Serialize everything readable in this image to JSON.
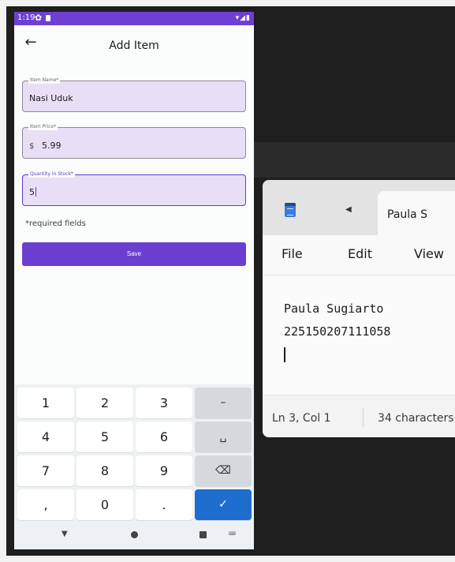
{
  "phone": {
    "status_bar": {
      "time": "1:19",
      "settings_icon": "gear-icon",
      "sys_icons": "▾◢▮"
    },
    "appbar": {
      "title": "Add Item",
      "back_icon": "arrow-left-icon"
    },
    "fields": {
      "item_name": {
        "label": "Item Name*",
        "value": "Nasi Uduk"
      },
      "item_price": {
        "label": "Item Price*",
        "prefix": "$",
        "value": "5.99"
      },
      "quantity": {
        "label": "Quantity in Stock*",
        "value": "5"
      }
    },
    "required_note": "*required fields",
    "save_label": "Save",
    "keypad": {
      "row1": [
        "1",
        "2",
        "3",
        "–"
      ],
      "row2": [
        "4",
        "5",
        "6",
        "␣"
      ],
      "row3": [
        "7",
        "8",
        "9",
        "⌫"
      ],
      "row4": [
        ",",
        "0",
        ".",
        "✓"
      ]
    },
    "navbar": {
      "back": "▼",
      "keyboard_switch": "⌨"
    }
  },
  "notepad": {
    "tab_title": "Paula S",
    "tab_left_arrow": "◀",
    "menu": {
      "file": "File",
      "edit": "Edit",
      "view": "View"
    },
    "lines": [
      "Paula Sugiarto",
      "225150207111058"
    ],
    "status": {
      "position": "Ln 3, Col 1",
      "characters": "34 characters"
    }
  },
  "colors": {
    "primary": "#6a3fd0",
    "field_fill": "#e8dff7",
    "keypad_done": "#1f6ecf",
    "status_bar": "#6f3fd3"
  }
}
